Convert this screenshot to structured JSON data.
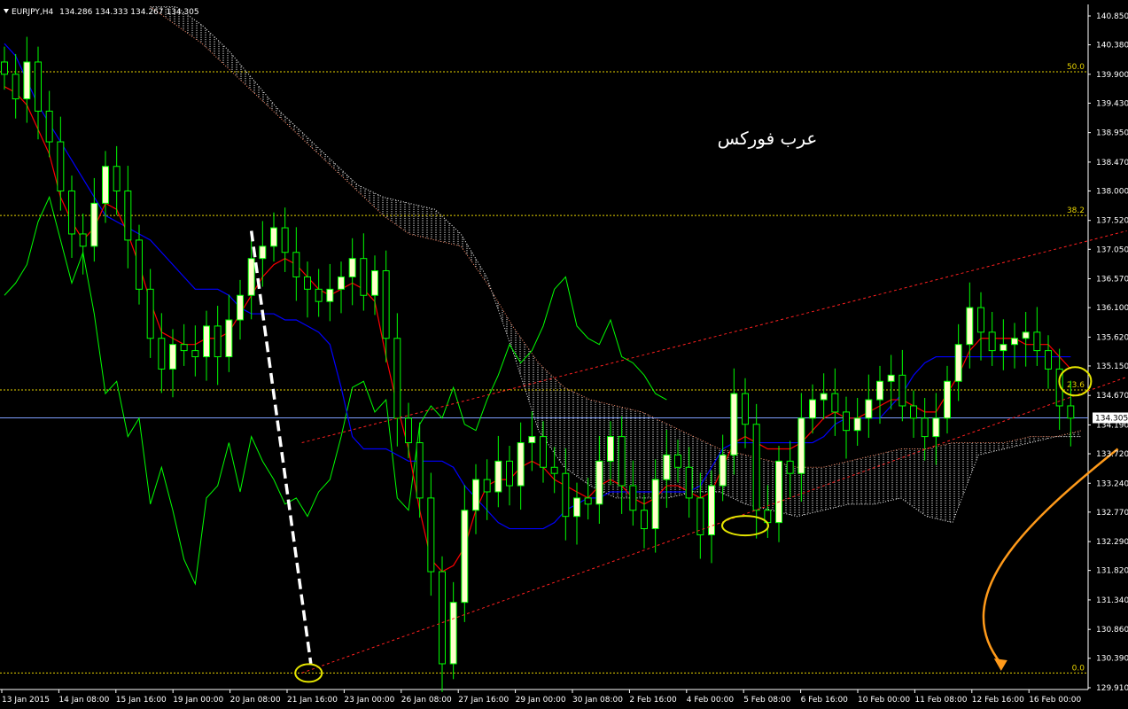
{
  "header": {
    "menu_icon": "triangle-down-icon",
    "symbol": "EURJPY,H4",
    "ohlc": "134.286 134.333 134.267 134.305"
  },
  "watermark": "عرب فوركس",
  "colors": {
    "background": "#000000",
    "bull_candle": "#ffffcc",
    "candle_outline": "#00ff00",
    "tenkan": "#ff0000",
    "kijun": "#0000ff",
    "chikou": "#00ff00",
    "cloud_a": "#ff8c69",
    "cloud_b": "#ffffff",
    "fib": "#e6d200",
    "channel": "#ff2020",
    "price_line": "#7f9fff",
    "white_dash": "#ffffff",
    "arrow": "#ff9a1a",
    "ellipse": "#e6e600"
  },
  "chart_data": {
    "type": "candlestick",
    "symbol": "EURJPY",
    "timeframe": "H4",
    "ylim": [
      129.91,
      140.85
    ],
    "y_ticks": [
      "140.850",
      "140.380",
      "139.900",
      "139.430",
      "138.950",
      "138.470",
      "138.000",
      "137.520",
      "137.050",
      "136.570",
      "136.100",
      "135.620",
      "135.150",
      "134.670",
      "134.190",
      "133.720",
      "133.240",
      "132.770",
      "132.290",
      "131.820",
      "131.340",
      "130.860",
      "130.390",
      "129.910"
    ],
    "x_ticks": [
      "13 Jan 2015",
      "14 Jan 08:00",
      "15 Jan 16:00",
      "19 Jan 00:00",
      "20 Jan 08:00",
      "21 Jan 16:00",
      "23 Jan 00:00",
      "26 Jan 08:00",
      "27 Jan 16:00",
      "29 Jan 00:00",
      "30 Jan 08:00",
      "2 Feb 16:00",
      "4 Feb 00:00",
      "5 Feb 08:00",
      "6 Feb 16:00",
      "10 Feb 00:00",
      "11 Feb 08:00",
      "12 Feb 16:00",
      "16 Feb 00:00"
    ],
    "current_price": "134.305",
    "fibonacci": [
      {
        "level": "50.0",
        "price": 139.94
      },
      {
        "level": "38.2",
        "price": 137.6
      },
      {
        "level": "23.6",
        "price": 134.76
      },
      {
        "level": "0.0",
        "price": 130.15
      }
    ],
    "closes": [
      139.9,
      139.5,
      140.1,
      139.3,
      138.8,
      138.0,
      137.3,
      137.1,
      137.8,
      138.4,
      138.0,
      137.2,
      136.4,
      135.6,
      135.1,
      135.5,
      135.4,
      135.3,
      135.8,
      135.3,
      135.9,
      136.3,
      136.9,
      137.1,
      137.4,
      137.0,
      136.6,
      136.4,
      136.2,
      136.4,
      136.6,
      136.9,
      136.3,
      136.7,
      135.6,
      134.3,
      133.9,
      133.0,
      131.8,
      130.3,
      131.3,
      132.8,
      133.3,
      133.1,
      133.6,
      133.2,
      133.9,
      134.0,
      133.5,
      133.4,
      132.7,
      133.0,
      132.9,
      133.6,
      134.0,
      133.2,
      132.8,
      132.5,
      133.3,
      133.7,
      133.5,
      133.0,
      132.4,
      133.2,
      133.7,
      134.7,
      134.2,
      132.8,
      132.6,
      133.6,
      133.4,
      134.3,
      134.6,
      134.7,
      134.4,
      134.1,
      134.3,
      134.6,
      134.9,
      135.0,
      134.5,
      134.3,
      134.0,
      134.3,
      134.9,
      135.5,
      136.1,
      135.7,
      135.4,
      135.5,
      135.6,
      135.7,
      135.4,
      135.1,
      134.5,
      134.3
    ],
    "tenkan": [
      139.7,
      139.6,
      139.4,
      139.0,
      138.6,
      137.9,
      137.5,
      137.2,
      137.4,
      137.8,
      137.7,
      137.3,
      136.8,
      136.2,
      135.7,
      135.6,
      135.5,
      135.5,
      135.6,
      135.6,
      135.7,
      136.0,
      136.3,
      136.6,
      136.8,
      136.9,
      136.8,
      136.6,
      136.4,
      136.3,
      136.4,
      136.5,
      136.4,
      136.2,
      135.3,
      134.5,
      133.8,
      132.8,
      132.0,
      131.8,
      131.9,
      132.2,
      132.8,
      133.2,
      133.3,
      133.3,
      133.5,
      133.6,
      133.5,
      133.3,
      133.2,
      133.1,
      133.0,
      133.2,
      133.3,
      133.2,
      133.0,
      132.9,
      133.0,
      133.2,
      133.2,
      133.1,
      133.0,
      133.1,
      133.5,
      133.9,
      134.0,
      133.9,
      133.8,
      133.8,
      133.8,
      133.9,
      134.1,
      134.3,
      134.4,
      134.3,
      134.3,
      134.4,
      134.5,
      134.6,
      134.6,
      134.5,
      134.4,
      134.4,
      134.7,
      135.0,
      135.4,
      135.6,
      135.6,
      135.6,
      135.6,
      135.5,
      135.5,
      135.5,
      135.3,
      135.1
    ],
    "kijun": [
      140.4,
      140.2,
      139.8,
      139.4,
      139.1,
      138.8,
      138.5,
      138.2,
      137.9,
      137.6,
      137.5,
      137.4,
      137.3,
      137.2,
      137.0,
      136.8,
      136.6,
      136.4,
      136.4,
      136.4,
      136.3,
      136.1,
      136.0,
      136.0,
      136.0,
      135.9,
      135.9,
      135.8,
      135.7,
      135.5,
      134.8,
      134.0,
      133.8,
      133.8,
      133.8,
      133.7,
      133.6,
      133.6,
      133.6,
      133.6,
      133.5,
      133.2,
      133.0,
      132.8,
      132.6,
      132.5,
      132.5,
      132.5,
      132.5,
      132.6,
      132.8,
      132.9,
      133.0,
      133.0,
      133.1,
      133.1,
      133.1,
      133.1,
      133.1,
      133.1,
      133.1,
      133.1,
      133.2,
      133.5,
      133.8,
      133.9,
      133.9,
      133.9,
      133.9,
      133.9,
      133.9,
      133.9,
      133.9,
      134.0,
      134.2,
      134.3,
      134.3,
      134.3,
      134.3,
      134.5,
      134.7,
      135.0,
      135.2,
      135.3,
      135.3,
      135.3,
      135.3,
      135.3,
      135.3,
      135.3,
      135.3,
      135.3,
      135.3,
      135.3,
      135.3,
      135.3
    ],
    "chikou": [
      136.3,
      136.5,
      136.8,
      137.5,
      137.9,
      137.2,
      136.5,
      137.0,
      136.0,
      134.7,
      134.9,
      134.0,
      134.3,
      132.9,
      133.5,
      132.8,
      132.0,
      131.6,
      133.0,
      133.2,
      133.9,
      133.1,
      134.0,
      133.6,
      133.3,
      132.9,
      133.0,
      132.7,
      133.1,
      133.3,
      134.0,
      134.8,
      134.9,
      134.4,
      134.6,
      133.0,
      132.8,
      134.2,
      134.5,
      134.3,
      134.8,
      134.2,
      134.1,
      134.6,
      135.0,
      135.5,
      135.2,
      135.4,
      135.8,
      136.4,
      136.6,
      135.8,
      135.6,
      135.5,
      135.9,
      135.3,
      135.2,
      135.0,
      134.7,
      134.6
    ],
    "cloud_a": [
      141.0,
      140.7,
      140.4,
      140.0,
      139.6,
      139.2,
      138.8,
      138.4,
      138.0,
      137.6,
      137.3,
      137.2,
      137.1,
      136.5,
      135.8,
      135.2,
      134.8,
      134.6,
      134.5,
      134.4,
      134.2,
      134.0,
      133.8,
      133.7,
      133.6,
      133.5,
      133.5,
      133.6,
      133.7,
      133.8,
      133.8,
      133.9,
      133.9,
      133.9,
      134.0,
      134.0,
      134.1
    ],
    "cloud_b": [
      141.0,
      141.0,
      140.7,
      140.3,
      139.8,
      139.3,
      138.9,
      138.5,
      138.1,
      137.9,
      137.8,
      137.7,
      137.3,
      136.6,
      135.4,
      134.1,
      133.5,
      133.2,
      133.0,
      133.0,
      133.0,
      133.1,
      133.1,
      132.9,
      132.8,
      132.7,
      132.8,
      132.9,
      132.9,
      133.0,
      132.7,
      132.6,
      133.7,
      133.8,
      133.9,
      134.0,
      134.0
    ],
    "channel_upper": [
      [
        26.5,
        133.9
      ],
      [
        100,
        137.35
      ]
    ],
    "channel_lower": [
      [
        26.5,
        130.15
      ],
      [
        100,
        134.97
      ]
    ],
    "white_trend": [
      [
        22,
        137.35
      ],
      [
        27.3,
        130.3
      ]
    ]
  }
}
